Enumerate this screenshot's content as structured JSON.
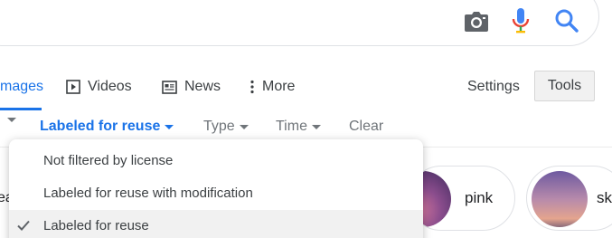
{
  "tabs": {
    "images": "mages",
    "videos": "Videos",
    "news": "News",
    "more": "More"
  },
  "toolbar": {
    "settings": "Settings",
    "tools": "Tools"
  },
  "filters": {
    "partial_caret_label": "",
    "license": "Labeled for reuse",
    "type": "Type",
    "time": "Time",
    "clear": "Clear"
  },
  "chips": {
    "left_partial": "ea",
    "pink": "pink",
    "sky": "sk"
  },
  "license_menu": {
    "items": [
      {
        "label": "Not filtered by license",
        "selected": false
      },
      {
        "label": "Labeled for reuse with modification",
        "selected": false
      },
      {
        "label": "Labeled for reuse",
        "selected": true
      }
    ]
  },
  "icons": {
    "camera": "camera-icon",
    "mic": "microphone-icon",
    "search": "search-icon",
    "video": "play-icon",
    "news": "newspaper-icon",
    "more": "vertical-dots-icon",
    "check": "check-icon"
  },
  "colors": {
    "accent": "#1a73e8",
    "text_muted": "#70757a",
    "menu_selected_bg": "#f1f1f1"
  }
}
